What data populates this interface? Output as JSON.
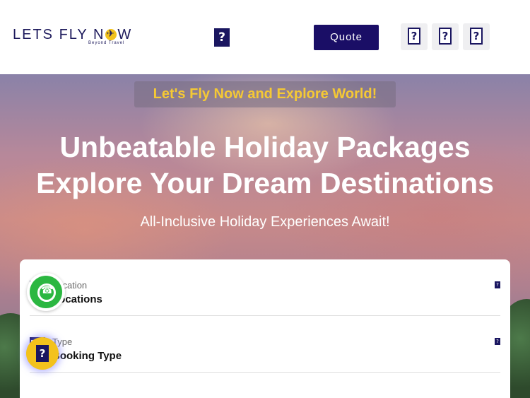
{
  "header": {
    "logo_text_pre": "LETS FLY N",
    "logo_text_post": "W",
    "logo_tagline": "Beyond Travel",
    "center_icon": "?",
    "quote_label": "Quote",
    "icon_buttons": [
      "?",
      "?",
      "?"
    ]
  },
  "hero": {
    "tagline": "Let's Fly Now and Explore World!",
    "title_line1": "Unbeatable Holiday Packages",
    "title_line2": "Explore Your Dream Destinations",
    "subtitle": "All-Inclusive Holiday Experiences Await!"
  },
  "form": {
    "fields": [
      {
        "small": "Location",
        "label": "Locations",
        "marker": "?"
      },
      {
        "small": "Type",
        "label": "Booking Type",
        "marker": "?"
      }
    ]
  },
  "widgets": {
    "help_icon": "?"
  },
  "colors": {
    "brand_navy": "#1a0e66",
    "accent_yellow": "#f3c21c",
    "tagline_yellow": "#f5c934",
    "whatsapp_green": "#2bb741"
  }
}
